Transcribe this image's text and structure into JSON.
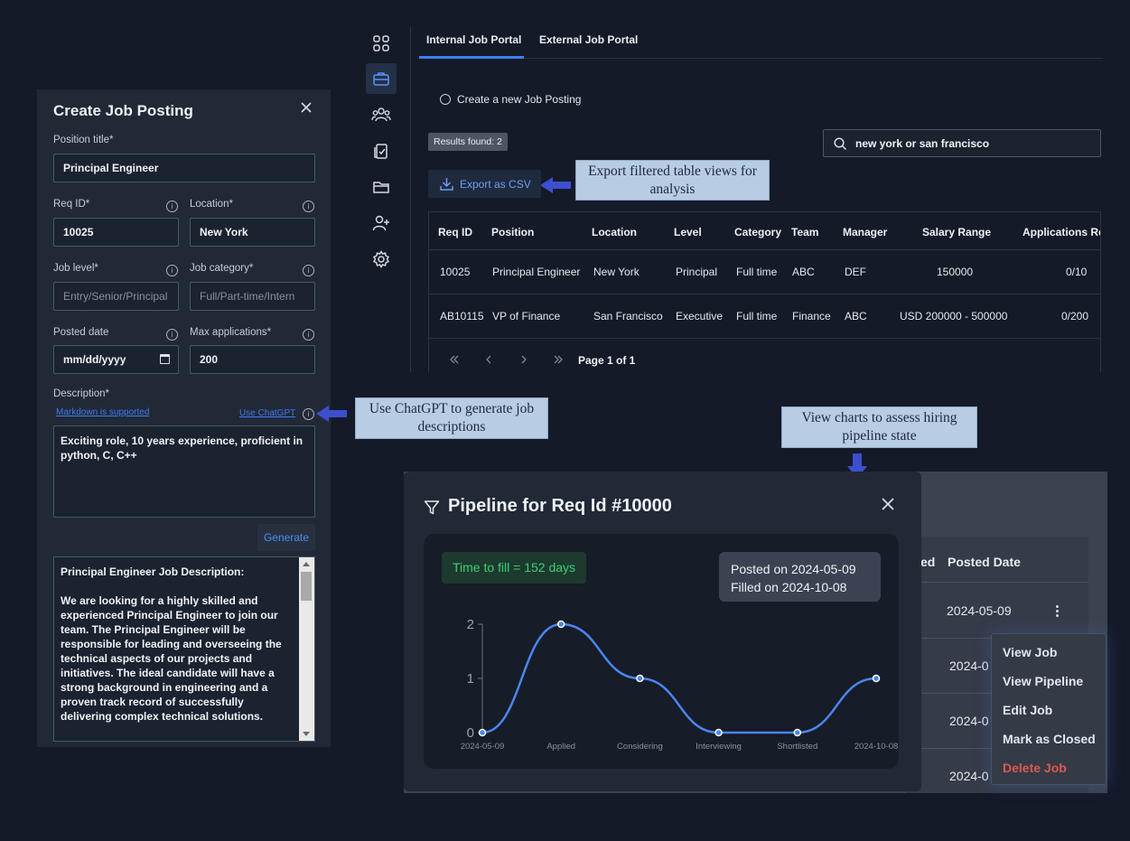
{
  "create_panel": {
    "title": "Create Job Posting",
    "position_title_label": "Position title*",
    "position_title_value": "Principal Engineer",
    "req_id_label": "Req ID*",
    "req_id_value": "10025",
    "location_label": "Location*",
    "location_value": "New York",
    "job_level_label": "Job level*",
    "job_level_placeholder": "Entry/Senior/Principal",
    "job_category_label": "Job category*",
    "job_category_placeholder": "Full/Part-time/Intern",
    "posted_date_label": "Posted date",
    "posted_date_placeholder": "mm/dd/yyyy",
    "max_applications_label": "Max applications*",
    "max_applications_value": "200",
    "description_label": "Description*",
    "markdown_link": "Markdown is supported",
    "chatgpt_link": "Use ChatGPT",
    "description_value": "Exciting role, 10 years experience, proficient in python, C, C++",
    "generate_label": "Generate",
    "generated_text": "Principal Engineer Job Description:\n\nWe are looking for a highly skilled and experienced Principal Engineer to join our team. The Principal Engineer will be responsible for leading and overseeing the technical aspects of our projects and initiatives. The ideal candidate will have a strong background in engineering and a proven track record of successfully delivering complex technical solutions.\n\nKey Responsibilities:"
  },
  "callouts": {
    "export": "Export filtered table views for analysis",
    "chatgpt": "Use ChatGPT to generate job descriptions",
    "charts": "View charts to assess hiring pipeline state"
  },
  "portal": {
    "tabs": [
      "Internal Job Portal",
      "External Job Portal"
    ],
    "create_link": "Create a new Job Posting",
    "results_badge": "Results found: 2",
    "search_value": "new york or san francisco",
    "export_label": "Export as CSV",
    "table": {
      "headers": [
        "Req ID",
        "Position",
        "Location",
        "Level",
        "Category",
        "Team",
        "Manager",
        "Salary Range",
        "Applications Re"
      ],
      "rows": [
        [
          "10025",
          "Principal Engineer",
          "New York",
          "Principal",
          "Full time",
          "ABC",
          "DEF",
          "150000",
          "0/10"
        ],
        [
          "AB10115",
          "VP of Finance",
          "San Francisco",
          "Executive",
          "Full time",
          "Finance",
          "ABC",
          "USD 200000 - 500000",
          "0/200"
        ]
      ]
    },
    "pager_label": "Page 1 of 1"
  },
  "background_list": {
    "headers": [
      "ed",
      "Posted Date"
    ],
    "dates": [
      "2024-05-09",
      "2024-0",
      "2024-0",
      "2024-0"
    ]
  },
  "context_menu": {
    "items": [
      "View Job",
      "View Pipeline",
      "Edit Job",
      "Mark as Closed",
      "Delete Job"
    ]
  },
  "pipeline_modal": {
    "title": "Pipeline for Req Id #10000",
    "time_to_fill": "Time to fill = 152 days",
    "posted_on": "Posted on 2024-05-09",
    "filled_on": "Filled on 2024-10-08"
  },
  "colors": {
    "accent": "#3f7ff2",
    "line": "#4a86f0",
    "success": "#3ecf74",
    "danger": "#e0584f"
  },
  "chart_data": {
    "type": "line",
    "categories": [
      "2024-05-09",
      "Applied",
      "Considering",
      "Interviewing",
      "Shortlisted",
      "2024-10-08"
    ],
    "values": [
      0,
      2,
      1,
      0,
      0,
      1
    ],
    "ylim": [
      0,
      2
    ],
    "yticks": [
      "0",
      "1",
      "2"
    ],
    "grid": false,
    "title": "",
    "xlabel": "",
    "ylabel": ""
  }
}
